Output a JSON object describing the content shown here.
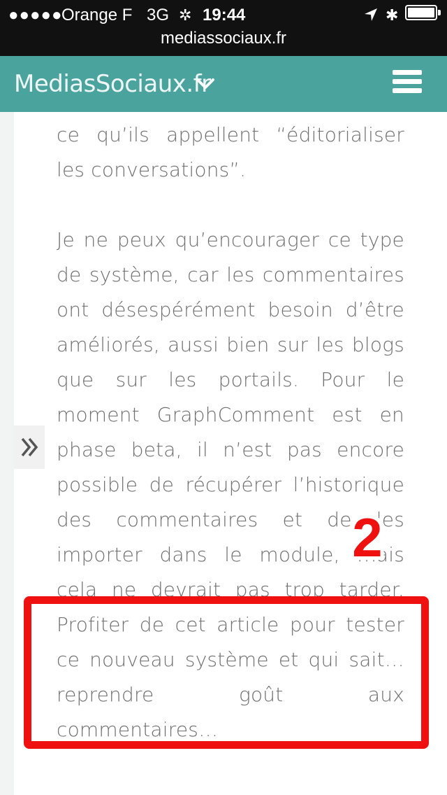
{
  "status_bar": {
    "signal": "●●●●●",
    "carrier": "Orange F",
    "network": "3G",
    "activity_icon": "✲",
    "time": "19:44",
    "location_icon": "location-arrow-icon",
    "bluetooth_icon": "✱",
    "battery_level": 1.0
  },
  "browser": {
    "url": "mediassociaux.fr"
  },
  "header": {
    "brand": "MediasSociaux.fr",
    "brand_menu_icon": "chevron-down-icon",
    "menu_icon": "hamburger-menu-icon",
    "accent_color": "#4aa39d"
  },
  "article": {
    "paragraph_1": "ce qu’ils appellent “éditorialiser les conversations”.",
    "paragraph_2_lines": [
      "Je ne peux qu’encourager ce type",
      "de système, car les commentaires",
      "ont désespérément besoin d’être",
      "améliorés, aussi bien sur les blogs",
      "que sur les portails. Pour le",
      "moment GraphComment est en",
      "phase beta, il n’est pas encore",
      "possible de récupérer l’historique",
      "des commentaires et de les",
      "importer dans le module, mais",
      "cela ne devrait pas trop tarder.",
      "Profiter de cet article pour tester",
      "ce nouveau système et qui sait…",
      "reprendre goût aux",
      "commentaires…"
    ]
  },
  "sidebar": {
    "expand_icon": "double-chevron-right-icon"
  },
  "annotation": {
    "step_number": "2",
    "color": "#ef1010"
  }
}
